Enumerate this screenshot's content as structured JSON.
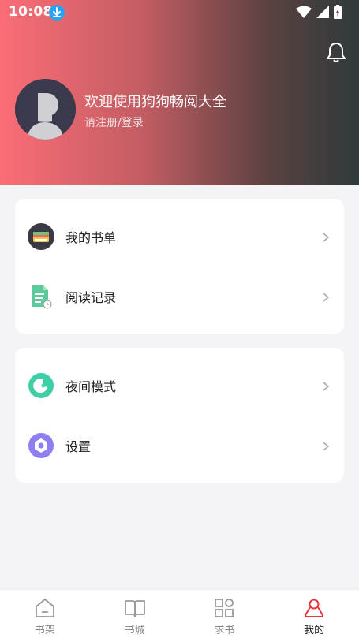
{
  "status_bar": {
    "time": "10:08"
  },
  "profile": {
    "welcome": "欢迎使用狗狗畅阅大全",
    "login_prompt": "请注册/登录"
  },
  "menu": {
    "group1": [
      {
        "label": "我的书单",
        "icon": "booklist-icon"
      },
      {
        "label": "阅读记录",
        "icon": "reading-history-icon"
      }
    ],
    "group2": [
      {
        "label": "夜间模式",
        "icon": "night-mode-icon"
      },
      {
        "label": "设置",
        "icon": "settings-icon"
      }
    ]
  },
  "tabbar": {
    "items": [
      {
        "label": "书架",
        "icon": "bookshelf-icon"
      },
      {
        "label": "书城",
        "icon": "bookstore-icon"
      },
      {
        "label": "求书",
        "icon": "request-book-icon"
      },
      {
        "label": "我的",
        "icon": "profile-icon"
      }
    ],
    "active_index": 3
  },
  "colors": {
    "header_gradient_start": "#fb6d76",
    "header_gradient_end": "#2e3a3b",
    "active_tab": "#e8343f",
    "night_mode_accent": "#3dcfa6",
    "settings_accent": "#8d7ff2",
    "reading_history_accent": "#5ec99a"
  }
}
